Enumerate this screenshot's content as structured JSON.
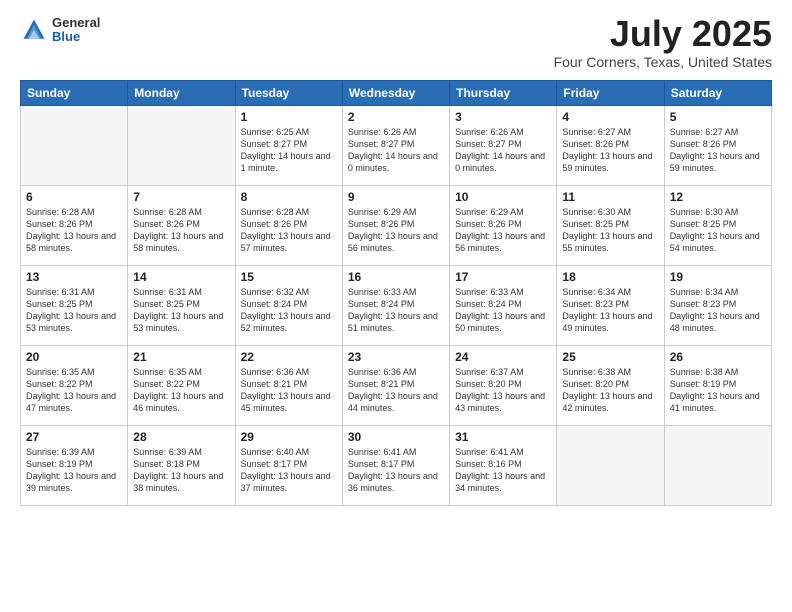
{
  "header": {
    "logo": {
      "general": "General",
      "blue": "Blue"
    },
    "title": "July 2025",
    "location": "Four Corners, Texas, United States"
  },
  "weekdays": [
    "Sunday",
    "Monday",
    "Tuesday",
    "Wednesday",
    "Thursday",
    "Friday",
    "Saturday"
  ],
  "weeks": [
    [
      {
        "day": "",
        "info": ""
      },
      {
        "day": "",
        "info": ""
      },
      {
        "day": "1",
        "info": "Sunrise: 6:25 AM\nSunset: 8:27 PM\nDaylight: 14 hours and 1 minute."
      },
      {
        "day": "2",
        "info": "Sunrise: 6:26 AM\nSunset: 8:27 PM\nDaylight: 14 hours and 0 minutes."
      },
      {
        "day": "3",
        "info": "Sunrise: 6:26 AM\nSunset: 8:27 PM\nDaylight: 14 hours and 0 minutes."
      },
      {
        "day": "4",
        "info": "Sunrise: 6:27 AM\nSunset: 8:26 PM\nDaylight: 13 hours and 59 minutes."
      },
      {
        "day": "5",
        "info": "Sunrise: 6:27 AM\nSunset: 8:26 PM\nDaylight: 13 hours and 59 minutes."
      }
    ],
    [
      {
        "day": "6",
        "info": "Sunrise: 6:28 AM\nSunset: 8:26 PM\nDaylight: 13 hours and 58 minutes."
      },
      {
        "day": "7",
        "info": "Sunrise: 6:28 AM\nSunset: 8:26 PM\nDaylight: 13 hours and 58 minutes."
      },
      {
        "day": "8",
        "info": "Sunrise: 6:28 AM\nSunset: 8:26 PM\nDaylight: 13 hours and 57 minutes."
      },
      {
        "day": "9",
        "info": "Sunrise: 6:29 AM\nSunset: 8:26 PM\nDaylight: 13 hours and 56 minutes."
      },
      {
        "day": "10",
        "info": "Sunrise: 6:29 AM\nSunset: 8:26 PM\nDaylight: 13 hours and 56 minutes."
      },
      {
        "day": "11",
        "info": "Sunrise: 6:30 AM\nSunset: 8:25 PM\nDaylight: 13 hours and 55 minutes."
      },
      {
        "day": "12",
        "info": "Sunrise: 6:30 AM\nSunset: 8:25 PM\nDaylight: 13 hours and 54 minutes."
      }
    ],
    [
      {
        "day": "13",
        "info": "Sunrise: 6:31 AM\nSunset: 8:25 PM\nDaylight: 13 hours and 53 minutes."
      },
      {
        "day": "14",
        "info": "Sunrise: 6:31 AM\nSunset: 8:25 PM\nDaylight: 13 hours and 53 minutes."
      },
      {
        "day": "15",
        "info": "Sunrise: 6:32 AM\nSunset: 8:24 PM\nDaylight: 13 hours and 52 minutes."
      },
      {
        "day": "16",
        "info": "Sunrise: 6:33 AM\nSunset: 8:24 PM\nDaylight: 13 hours and 51 minutes."
      },
      {
        "day": "17",
        "info": "Sunrise: 6:33 AM\nSunset: 8:24 PM\nDaylight: 13 hours and 50 minutes."
      },
      {
        "day": "18",
        "info": "Sunrise: 6:34 AM\nSunset: 8:23 PM\nDaylight: 13 hours and 49 minutes."
      },
      {
        "day": "19",
        "info": "Sunrise: 6:34 AM\nSunset: 8:23 PM\nDaylight: 13 hours and 48 minutes."
      }
    ],
    [
      {
        "day": "20",
        "info": "Sunrise: 6:35 AM\nSunset: 8:22 PM\nDaylight: 13 hours and 47 minutes."
      },
      {
        "day": "21",
        "info": "Sunrise: 6:35 AM\nSunset: 8:22 PM\nDaylight: 13 hours and 46 minutes."
      },
      {
        "day": "22",
        "info": "Sunrise: 6:36 AM\nSunset: 8:21 PM\nDaylight: 13 hours and 45 minutes."
      },
      {
        "day": "23",
        "info": "Sunrise: 6:36 AM\nSunset: 8:21 PM\nDaylight: 13 hours and 44 minutes."
      },
      {
        "day": "24",
        "info": "Sunrise: 6:37 AM\nSunset: 8:20 PM\nDaylight: 13 hours and 43 minutes."
      },
      {
        "day": "25",
        "info": "Sunrise: 6:38 AM\nSunset: 8:20 PM\nDaylight: 13 hours and 42 minutes."
      },
      {
        "day": "26",
        "info": "Sunrise: 6:38 AM\nSunset: 8:19 PM\nDaylight: 13 hours and 41 minutes."
      }
    ],
    [
      {
        "day": "27",
        "info": "Sunrise: 6:39 AM\nSunset: 8:19 PM\nDaylight: 13 hours and 39 minutes."
      },
      {
        "day": "28",
        "info": "Sunrise: 6:39 AM\nSunset: 8:18 PM\nDaylight: 13 hours and 38 minutes."
      },
      {
        "day": "29",
        "info": "Sunrise: 6:40 AM\nSunset: 8:17 PM\nDaylight: 13 hours and 37 minutes."
      },
      {
        "day": "30",
        "info": "Sunrise: 6:41 AM\nSunset: 8:17 PM\nDaylight: 13 hours and 36 minutes."
      },
      {
        "day": "31",
        "info": "Sunrise: 6:41 AM\nSunset: 8:16 PM\nDaylight: 13 hours and 34 minutes."
      },
      {
        "day": "",
        "info": ""
      },
      {
        "day": "",
        "info": ""
      }
    ]
  ]
}
